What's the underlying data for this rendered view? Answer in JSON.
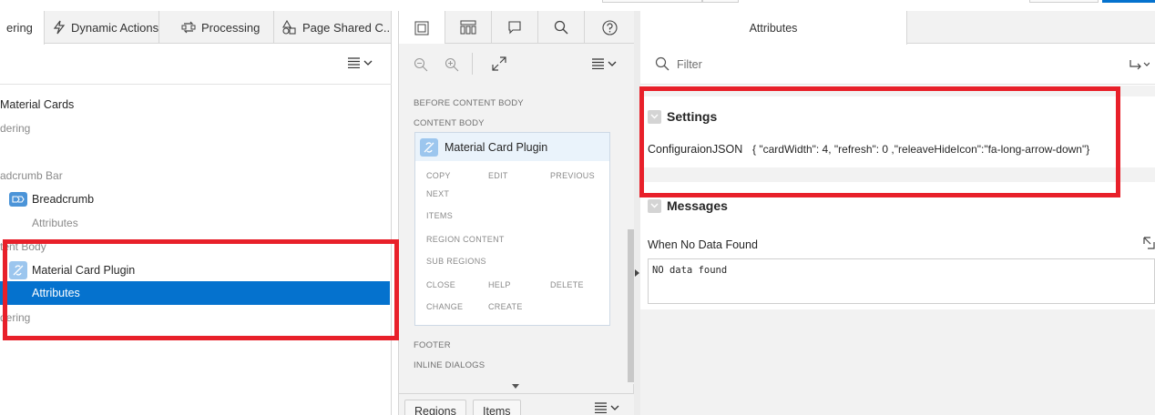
{
  "left_panel": {
    "tabs": [
      {
        "label": "ering",
        "icon": "rendering-icon"
      },
      {
        "label": "Dynamic Actions",
        "icon": "lightning-icon"
      },
      {
        "label": "Processing",
        "icon": "processing-icon"
      },
      {
        "label": "Page Shared C...",
        "icon": "shapes-icon"
      }
    ],
    "tree": [
      {
        "label": "Material Cards",
        "muted": false
      },
      {
        "label": "dering",
        "muted": true
      },
      {
        "label": "adcrumb Bar",
        "muted": true
      },
      {
        "label": "Breadcrumb",
        "muted": false
      },
      {
        "label": "Attributes",
        "muted": true
      },
      {
        "label": "tent Body",
        "muted": true
      },
      {
        "label": "Material Card Plugin",
        "muted": false
      },
      {
        "label": "Attributes",
        "muted": false,
        "selected": true
      },
      {
        "label": "dering",
        "muted": true
      }
    ]
  },
  "middle_panel": {
    "labels": {
      "before_content_body": "BEFORE CONTENT BODY",
      "content_body": "CONTENT BODY",
      "footer": "FOOTER",
      "inline_dialogs": "INLINE DIALOGS"
    },
    "region_card_title": "Material Card Plugin",
    "positions": [
      "COPY",
      "EDIT",
      "PREVIOUS",
      "NEXT",
      "ITEMS",
      "REGION CONTENT",
      "SUB REGIONS",
      "CLOSE",
      "HELP",
      "DELETE",
      "CHANGE",
      "CREATE"
    ],
    "bottom_buttons": [
      "Regions",
      "Items"
    ]
  },
  "right_panel": {
    "tab_label": "Attributes",
    "filter_placeholder": "Filter",
    "settings": {
      "title": "Settings",
      "prop_label": "ConfiguraionJSON",
      "prop_value": "{ \"cardWidth\": 4, \"refresh\": 0 ,\"releaveHideIcon\":\"fa-long-arrow-down\"}"
    },
    "messages": {
      "title": "Messages",
      "prop_label": "When No Data Found",
      "prop_value": "NO data found"
    }
  },
  "colors": {
    "highlight": "#e8202a",
    "selection": "#0572ce"
  }
}
